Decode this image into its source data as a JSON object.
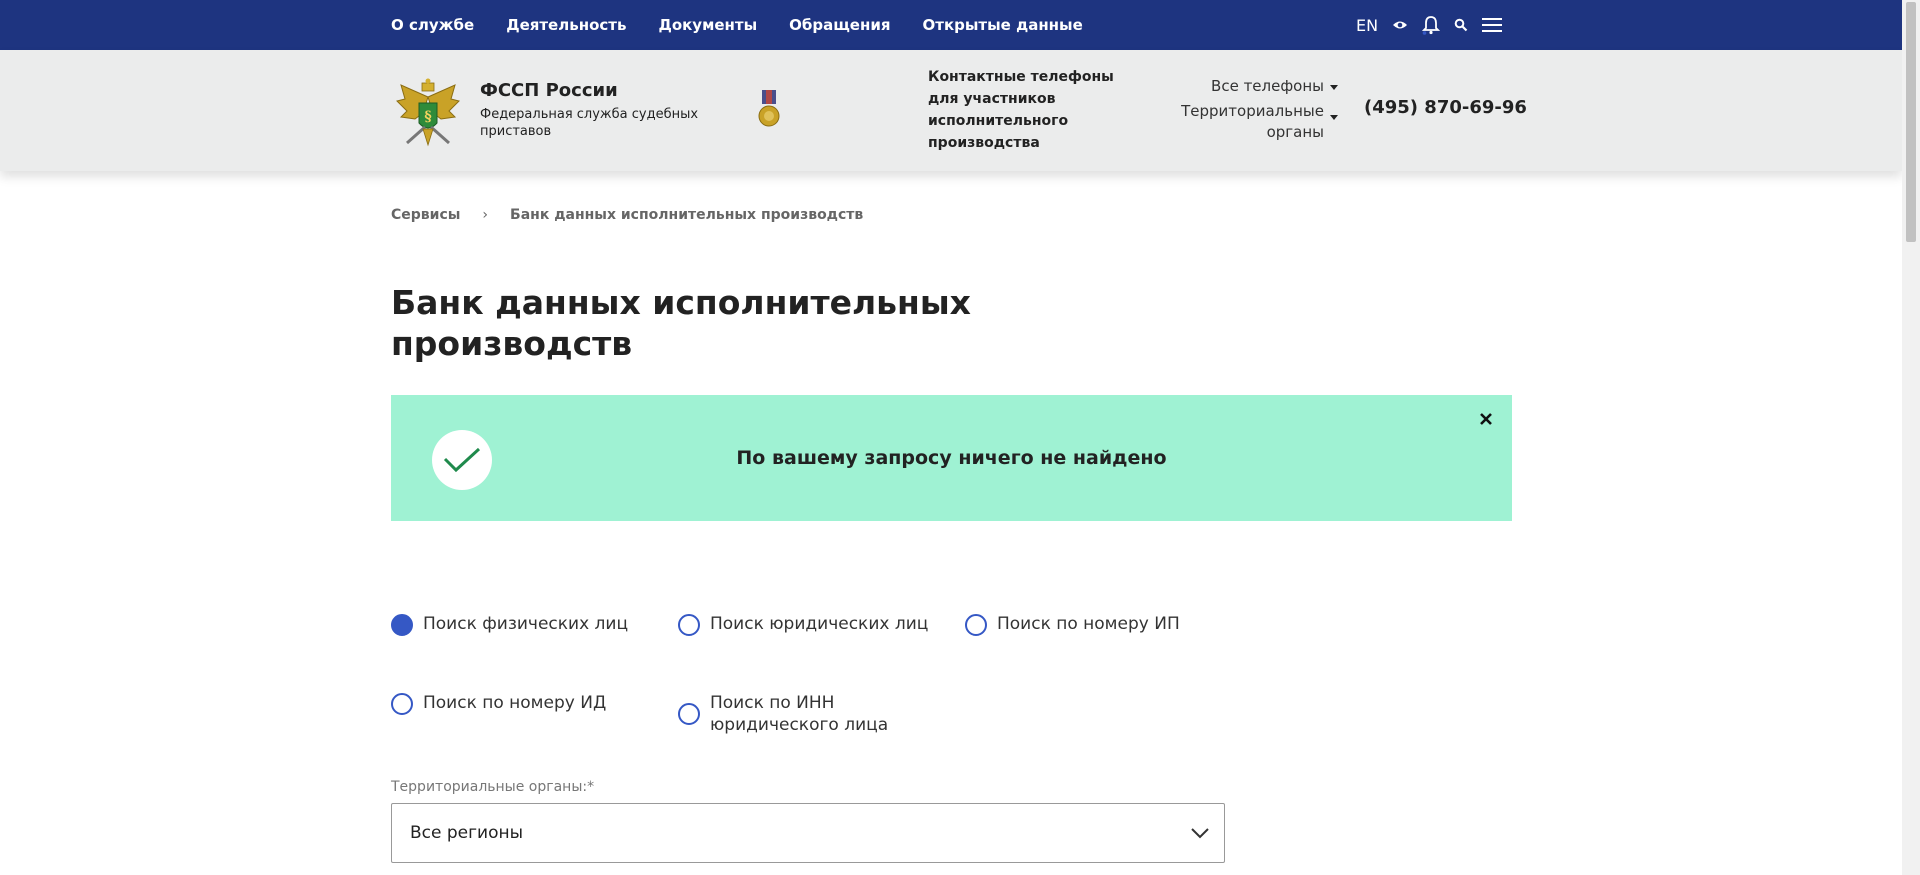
{
  "topnav": {
    "items": [
      "О службе",
      "Деятельность",
      "Документы",
      "Обращения",
      "Открытые данные"
    ],
    "lang": "EN"
  },
  "header": {
    "title": "ФССП России",
    "subtitle": "Федеральная служба судебных приставов",
    "contacts_title": "Контактные телефоны для участников исполнительного производства",
    "all_phones": "Все телефоны",
    "territorial": "Территориальные органы",
    "phone": "(495) 870-69-96"
  },
  "breadcrumb": {
    "items": [
      "Сервисы",
      "Банк данных исполнительных производств"
    ],
    "separator": "›"
  },
  "page": {
    "title": "Банк данных исполнительных производств"
  },
  "alert": {
    "message": "По вашему запросу ничего не найдено",
    "close": "×",
    "bg_color": "#9ff2d3"
  },
  "search_types": [
    {
      "label": "Поиск физических лиц",
      "checked": true
    },
    {
      "label": "Поиск юридических лиц",
      "checked": false
    },
    {
      "label": "Поиск по номеру ИП",
      "checked": false
    },
    {
      "label": "Поиск по номеру ИД",
      "checked": false
    },
    {
      "label": "Поиск по ИНН юридического лица",
      "checked": false
    }
  ],
  "region": {
    "label": "Территориальные органы:*",
    "value": "Все регионы"
  },
  "colors": {
    "primary": "#1e3480",
    "accent": "#3558c5",
    "header_bg": "#ebecec"
  },
  "icons": [
    "eye-icon",
    "bell-icon",
    "search-icon",
    "menu-icon",
    "check-icon",
    "close-icon",
    "chevron-down-icon"
  ]
}
